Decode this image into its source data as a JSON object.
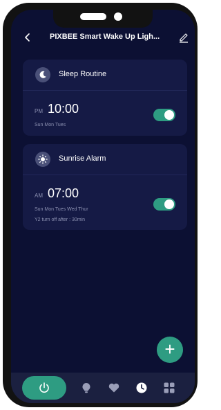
{
  "header": {
    "title": "PIXBEE Smart Wake Up Ligh...",
    "back_icon": "chevron-left-icon",
    "edit_icon": "pencil-icon"
  },
  "alarms": [
    {
      "name": "Sleep Routine",
      "icon": "moon-icon",
      "ampm": "PM",
      "time": "10:00",
      "days": "Sun Mon Tues",
      "note": "",
      "enabled": true
    },
    {
      "name": "Sunrise Alarm",
      "icon": "sun-icon",
      "ampm": "AM",
      "time": "07:00",
      "days": "Sun Mon Tues Wed Thur",
      "note": "Y2 turn off after : 30min",
      "enabled": true
    }
  ],
  "fab": {
    "label": "+",
    "icon": "plus-icon"
  },
  "bottom_nav": {
    "items": [
      "power-icon",
      "bulb-icon",
      "heart-icon",
      "clock-icon",
      "grid-icon"
    ],
    "active": "clock-icon"
  },
  "colors": {
    "background": "#0c1033",
    "card": "#151a45",
    "accent": "#2e9c82",
    "nav_bar": "#1b2040"
  }
}
